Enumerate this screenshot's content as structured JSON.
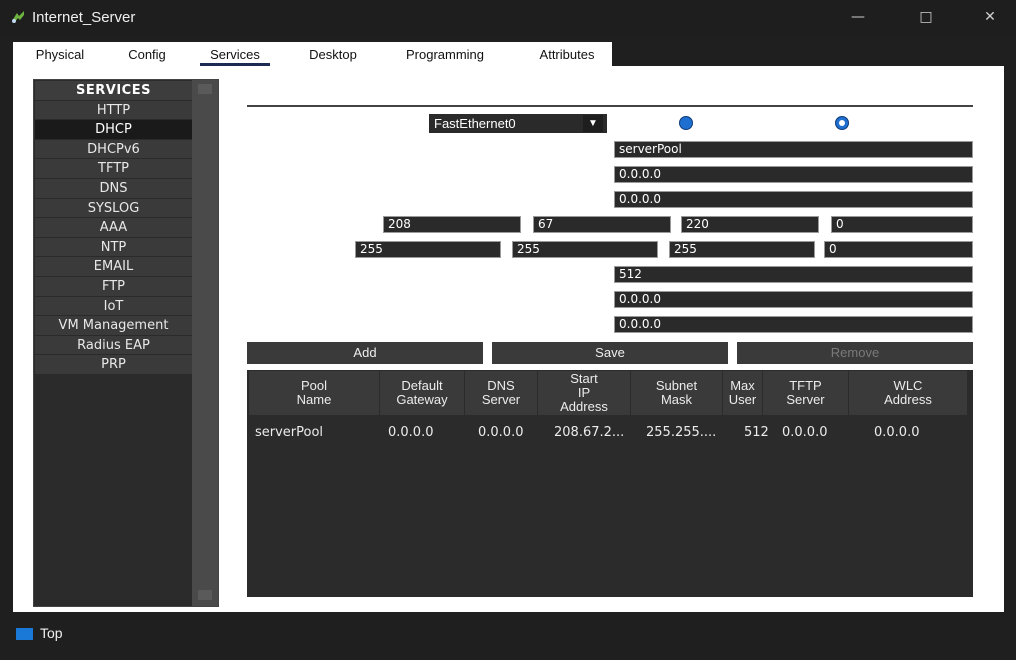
{
  "window": {
    "title": "Internet_Server",
    "controls": {
      "minimize": "—",
      "maximize": "□",
      "close": "✕"
    }
  },
  "tabs": [
    {
      "label": "Physical"
    },
    {
      "label": "Config"
    },
    {
      "label": "Services",
      "active": true
    },
    {
      "label": "Desktop"
    },
    {
      "label": "Programming"
    },
    {
      "label": "Attributes"
    }
  ],
  "sidebar": {
    "header": "SERVICES",
    "items": [
      {
        "label": "HTTP"
      },
      {
        "label": "DHCP",
        "active": true
      },
      {
        "label": "DHCPv6"
      },
      {
        "label": "TFTP"
      },
      {
        "label": "DNS"
      },
      {
        "label": "SYSLOG"
      },
      {
        "label": "AAA"
      },
      {
        "label": "NTP"
      },
      {
        "label": "EMAIL"
      },
      {
        "label": "FTP"
      },
      {
        "label": "IoT"
      },
      {
        "label": "VM Management"
      },
      {
        "label": "Radius EAP"
      },
      {
        "label": "PRP"
      }
    ]
  },
  "form": {
    "interface": "FastEthernet0",
    "interface_arrow": "▼",
    "service_off_selected": false,
    "service_on_selected": true,
    "pool_name": "serverPool",
    "default_gateway": "0.0.0.0",
    "dns_server": "0.0.0.0",
    "start_ip": [
      "208",
      "67",
      "220",
      "0"
    ],
    "subnet_mask": [
      "255",
      "255",
      "255",
      "0"
    ],
    "max_users": "512",
    "tftp_server": "0.0.0.0",
    "wlc_address": "0.0.0.0"
  },
  "buttons": {
    "add": "Add",
    "save": "Save",
    "remove": "Remove"
  },
  "table": {
    "headers": {
      "pool": "Pool\nName",
      "gateway": "Default\nGateway",
      "dns": "DNS\nServer",
      "start": "Start\nIP\nAddress",
      "subnet": "Subnet\nMask",
      "max": "Max\nUser",
      "tftp": "TFTP\nServer",
      "wlc": "WLC\nAddress"
    },
    "rows": [
      {
        "pool": "serverPool",
        "gateway": "0.0.0.0",
        "dns": "0.0.0.0",
        "start": "208.67.2...",
        "subnet": "255.255....",
        "max": "512",
        "tftp": "0.0.0.0",
        "wlc": "0.0.0.0"
      }
    ]
  },
  "statusbar": {
    "checkbox_label": "Top",
    "checkbox_color": "#1a78d6"
  },
  "colors": {
    "accent": "#1f6fd0",
    "panel": "#2b2b2b",
    "titlebar": "#1e1e1e"
  }
}
